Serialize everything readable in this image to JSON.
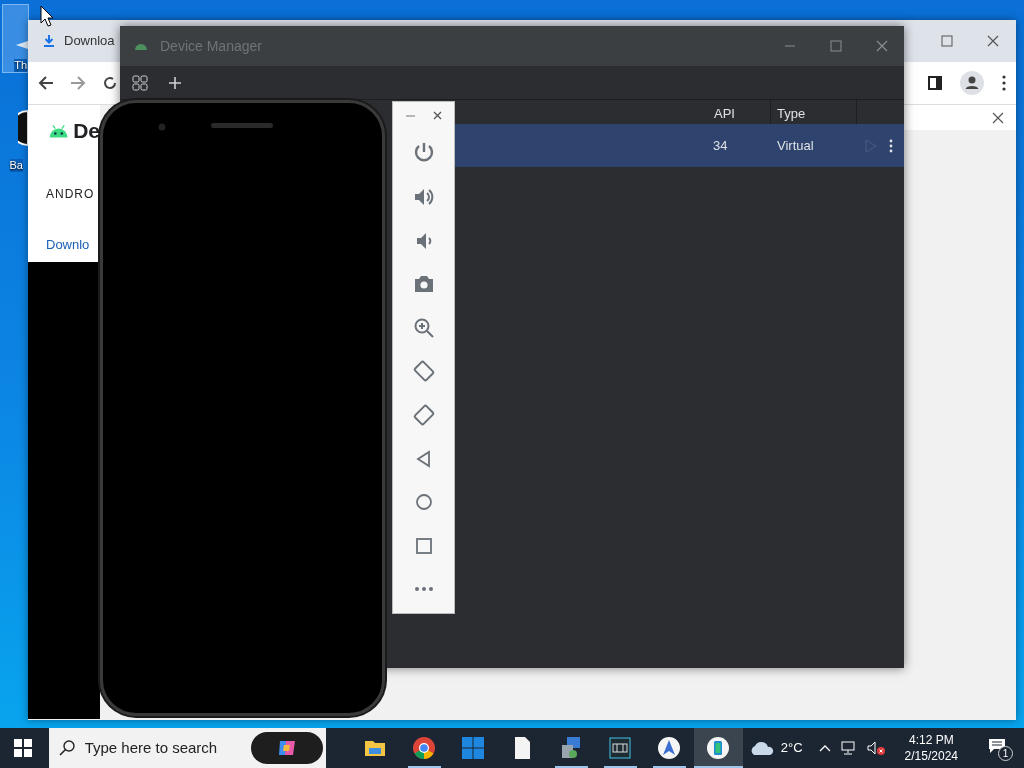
{
  "desktop_icons": [
    {
      "label": "Th",
      "selected": true
    },
    {
      "label": "Ba",
      "selected": false
    }
  ],
  "browser": {
    "tab_title": "Downloa",
    "site_title": "De",
    "nav_heading": "ANDRO",
    "nav_tab": "Downlo"
  },
  "device_manager": {
    "title": "Device Manager",
    "columns": [
      "API",
      "Type"
    ],
    "rows": [
      {
        "api": "34",
        "type": "Virtual",
        "selected": true
      }
    ]
  },
  "emulator_toolbar": {
    "buttons": [
      {
        "kind": "power"
      },
      {
        "kind": "volume_up"
      },
      {
        "kind": "volume_down"
      },
      {
        "kind": "camera"
      },
      {
        "kind": "zoom"
      },
      {
        "kind": "rotate_left"
      },
      {
        "kind": "rotate_right"
      },
      {
        "kind": "back"
      },
      {
        "kind": "home"
      },
      {
        "kind": "overview"
      },
      {
        "kind": "more"
      }
    ]
  },
  "taskbar": {
    "search_placeholder": "Type here to search",
    "apps": [
      {
        "kind": "folder",
        "running": false,
        "active": false
      },
      {
        "kind": "browser",
        "running": true,
        "active": false
      },
      {
        "kind": "grid",
        "running": false,
        "active": false
      },
      {
        "kind": "document",
        "running": false,
        "active": false
      },
      {
        "kind": "installer",
        "running": true,
        "active": false
      },
      {
        "kind": "film",
        "running": true,
        "active": false
      },
      {
        "kind": "compass",
        "running": true,
        "active": false
      },
      {
        "kind": "phone",
        "running": true,
        "active": true
      }
    ],
    "weather": "2°C",
    "time": "4:12 PM",
    "date": "2/15/2024",
    "notifications": "1"
  }
}
